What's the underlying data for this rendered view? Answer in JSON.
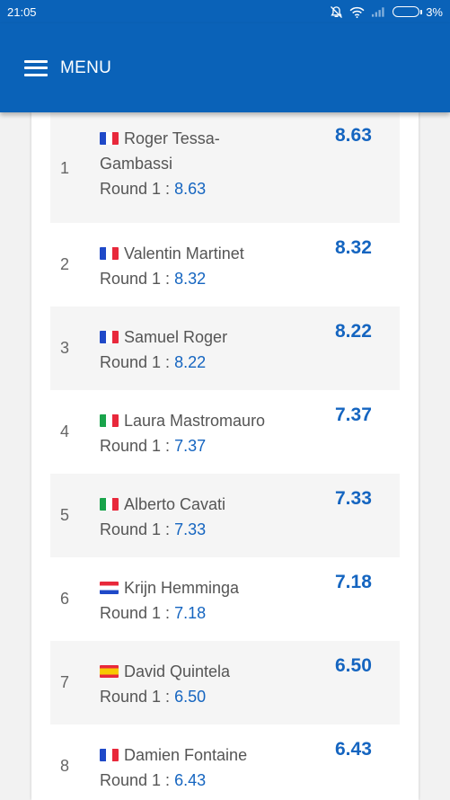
{
  "status_bar": {
    "time": "21:05",
    "battery": "3%"
  },
  "app_bar": {
    "menu_label": "MENU"
  },
  "round_label": "Round 1 :",
  "rankings": [
    {
      "rank": "1",
      "flag": "fr",
      "name": "Roger Tessa-Gambassi",
      "round_score": "8.63",
      "score": "8.63"
    },
    {
      "rank": "2",
      "flag": "fr",
      "name": "Valentin Martinet",
      "round_score": "8.32",
      "score": "8.32"
    },
    {
      "rank": "3",
      "flag": "fr",
      "name": "Samuel Roger",
      "round_score": "8.22",
      "score": "8.22"
    },
    {
      "rank": "4",
      "flag": "it",
      "name": "Laura Mastromauro",
      "round_score": "7.37",
      "score": "7.37"
    },
    {
      "rank": "5",
      "flag": "it",
      "name": "Alberto Cavati",
      "round_score": "7.33",
      "score": "7.33"
    },
    {
      "rank": "6",
      "flag": "nl",
      "name": "Krijn Hemminga",
      "round_score": "7.18",
      "score": "7.18"
    },
    {
      "rank": "7",
      "flag": "es",
      "name": "David Quintela",
      "round_score": "6.50",
      "score": "6.50"
    },
    {
      "rank": "8",
      "flag": "fr",
      "name": "Damien Fontaine",
      "round_score": "6.43",
      "score": "6.43"
    }
  ]
}
